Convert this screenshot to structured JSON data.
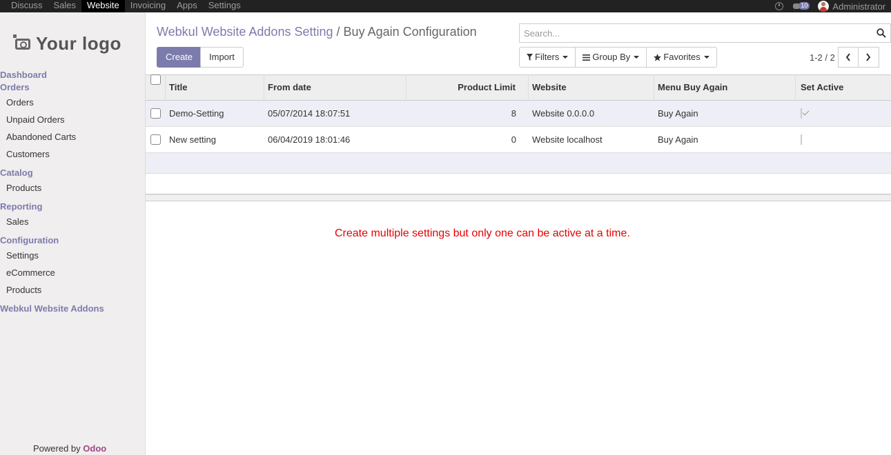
{
  "topbar": {
    "menu": [
      "Discuss",
      "Sales",
      "Website",
      "Invoicing",
      "Apps",
      "Settings"
    ],
    "active": "Website",
    "notifications": "10",
    "user": "Administrator"
  },
  "sidebar": {
    "logo_text": "Your logo",
    "sections": [
      {
        "title": "Dashboard",
        "items": []
      },
      {
        "title": "Orders",
        "items": [
          "Orders",
          "Unpaid Orders",
          "Abandoned Carts",
          "Customers"
        ]
      },
      {
        "title": "Catalog",
        "items": [
          "Products"
        ]
      },
      {
        "title": "Reporting",
        "items": [
          "Sales"
        ]
      },
      {
        "title": "Configuration",
        "items": [
          "Settings",
          "eCommerce",
          "Products"
        ]
      },
      {
        "title": "Webkul Website Addons",
        "items": []
      }
    ],
    "powered_by": "Powered by",
    "powered_brand": "Odoo"
  },
  "breadcrumb": {
    "parent": "Webkul Website Addons Setting",
    "separator": "/",
    "current": "Buy Again Configuration"
  },
  "search": {
    "placeholder": "Search..."
  },
  "buttons": {
    "create": "Create",
    "import": "Import"
  },
  "filters": {
    "filters": "Filters",
    "group_by": "Group By",
    "favorites": "Favorites"
  },
  "pager": {
    "value": "1-2 / 2"
  },
  "table": {
    "headers": [
      "Title",
      "From date",
      "Product Limit",
      "Website",
      "Menu Buy Again",
      "Set Active"
    ],
    "rows": [
      {
        "title": "Demo-Setting",
        "from_date": "05/07/2014 18:07:51",
        "limit": "8",
        "website": "Website 0.0.0.0",
        "menu": "Buy Again",
        "active": true
      },
      {
        "title": "New setting",
        "from_date": "06/04/2019 18:01:46",
        "limit": "0",
        "website": "Website localhost",
        "menu": "Buy Again",
        "active": false
      }
    ]
  },
  "note": "Create multiple settings but only one can be active at a time."
}
